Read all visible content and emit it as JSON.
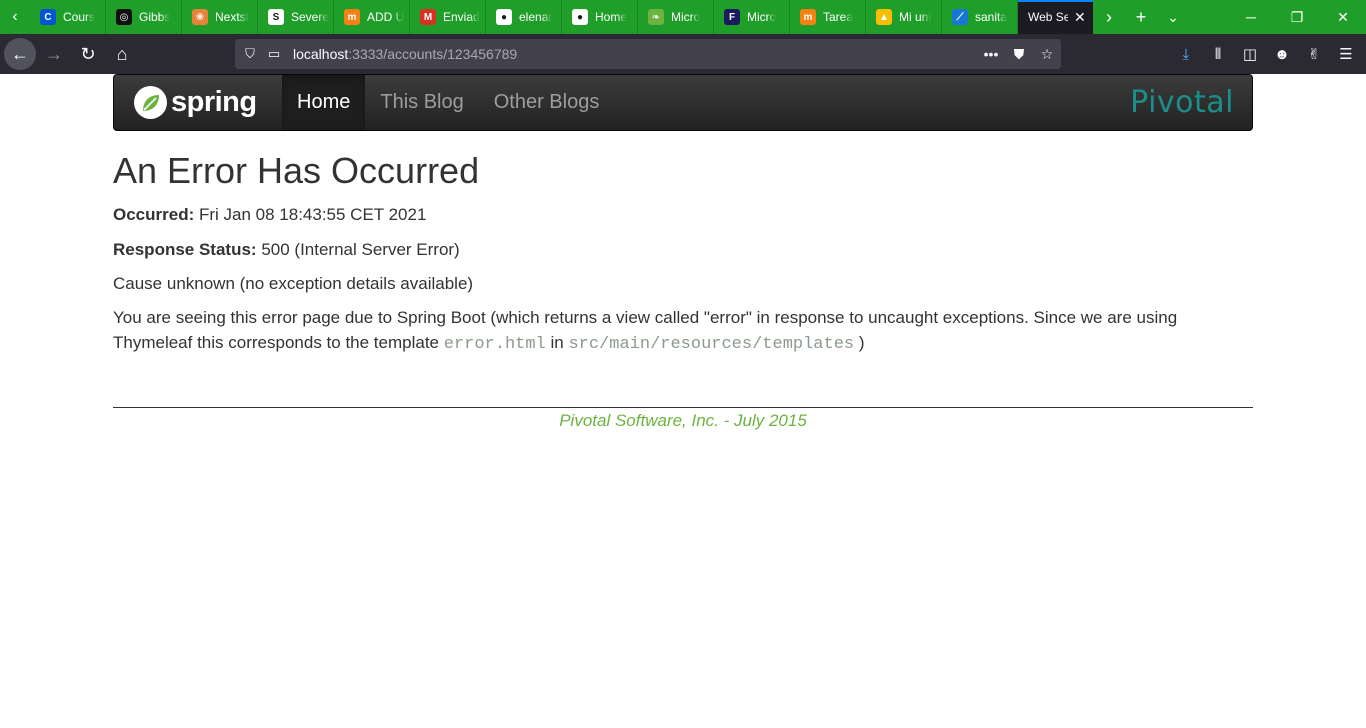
{
  "browser": {
    "tabs": [
      {
        "label": "Cours",
        "favicon": "coursera-icon",
        "color": "#0056d2",
        "glyph": "C"
      },
      {
        "label": "Gibbs",
        "favicon": "gibbs-icon",
        "color": "#111111",
        "glyph": "◎"
      },
      {
        "label": "Nextst",
        "favicon": "nextstep-icon",
        "color": "#e8813a",
        "glyph": "❀"
      },
      {
        "label": "Severe",
        "favicon": "document-icon",
        "color": "#ffffff",
        "glyph": "S"
      },
      {
        "label": "ADD U",
        "favicon": "moodle-icon",
        "color": "#f98012",
        "glyph": "m"
      },
      {
        "label": "Enviad",
        "favicon": "gmail-icon",
        "color": "#d93025",
        "glyph": "M"
      },
      {
        "label": "elenar",
        "favicon": "github-icon",
        "color": "#ffffff",
        "glyph": "●"
      },
      {
        "label": "Home",
        "favicon": "github-icon",
        "color": "#ffffff",
        "glyph": "●"
      },
      {
        "label": "Micro",
        "favicon": "spring-icon",
        "color": "#6db33f",
        "glyph": "❧"
      },
      {
        "label": "Micro",
        "favicon": "f-icon",
        "color": "#1a1a5e",
        "glyph": "F"
      },
      {
        "label": "Tarea",
        "favicon": "moodle-icon",
        "color": "#f98012",
        "glyph": "m"
      },
      {
        "label": "Mi uni",
        "favicon": "google-drive-icon",
        "color": "#fbbc04",
        "glyph": "▲"
      },
      {
        "label": "sanita",
        "favicon": "chart-icon",
        "color": "#1976d2",
        "glyph": "⟋"
      }
    ],
    "active_tab": {
      "label": "Web Se",
      "close": "✕"
    },
    "url": {
      "host": "localhost",
      "path": ":3333/accounts/123456789"
    }
  },
  "site": {
    "brand": "spring",
    "nav": [
      {
        "label": "Home",
        "active": true
      },
      {
        "label": "This Blog",
        "active": false
      },
      {
        "label": "Other Blogs",
        "active": false
      }
    ],
    "partner_logo": "Pivotal",
    "brand_color": "#6db33f",
    "partner_color": "#1b8e89"
  },
  "error": {
    "title": "An Error Has Occurred",
    "occurred_label": "Occurred:",
    "occurred_value": " Fri Jan 08 18:43:55 CET 2021",
    "status_label": "Response Status:",
    "status_value": " 500 (Internal Server Error)",
    "cause": "Cause unknown (no exception details available)",
    "explanation_1": "You are seeing this error page due to Spring Boot (which returns a view called \"error\" in response to uncaught exceptions. Since we are using Thymeleaf this corresponds to the template ",
    "template_file": "error.html",
    "in_word": " in ",
    "template_dir": "src/main/resources/templates",
    "explanation_end": " )"
  },
  "footer": {
    "text": "Pivotal Software, Inc. - July 2015"
  }
}
